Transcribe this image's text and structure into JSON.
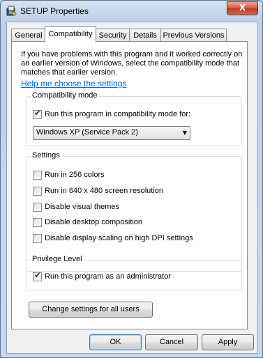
{
  "window": {
    "title": "SETUP Properties",
    "close_glyph": "X"
  },
  "tabs": [
    {
      "label": "General"
    },
    {
      "label": "Compatibility"
    },
    {
      "label": "Security"
    },
    {
      "label": "Details"
    },
    {
      "label": "Previous Versions"
    }
  ],
  "intro_text": "If you have problems with this program and it worked correctly on an earlier version of Windows, select the compatibility mode that matches that earlier version.",
  "help_link": "Help me choose the settings",
  "compat_mode": {
    "title": "Compatibility mode",
    "checkbox_label": "Run this program in compatibility mode for:",
    "checked": true,
    "selected_os": "Windows XP (Service Pack 2)"
  },
  "settings": {
    "title": "Settings",
    "items": [
      {
        "label": "Run in 256 colors",
        "checked": false
      },
      {
        "label": "Run in 640 x 480 screen resolution",
        "checked": false
      },
      {
        "label": "Disable visual themes",
        "checked": false
      },
      {
        "label": "Disable desktop composition",
        "checked": false
      },
      {
        "label": "Disable display scaling on high DPI settings",
        "checked": false
      }
    ]
  },
  "privilege": {
    "title": "Privilege Level",
    "checkbox_label": "Run this program as an administrator",
    "checked": true
  },
  "change_all_button": "Change settings for all users",
  "footer": {
    "ok": "OK",
    "cancel": "Cancel",
    "apply": "Apply"
  },
  "check_glyph": "✔"
}
